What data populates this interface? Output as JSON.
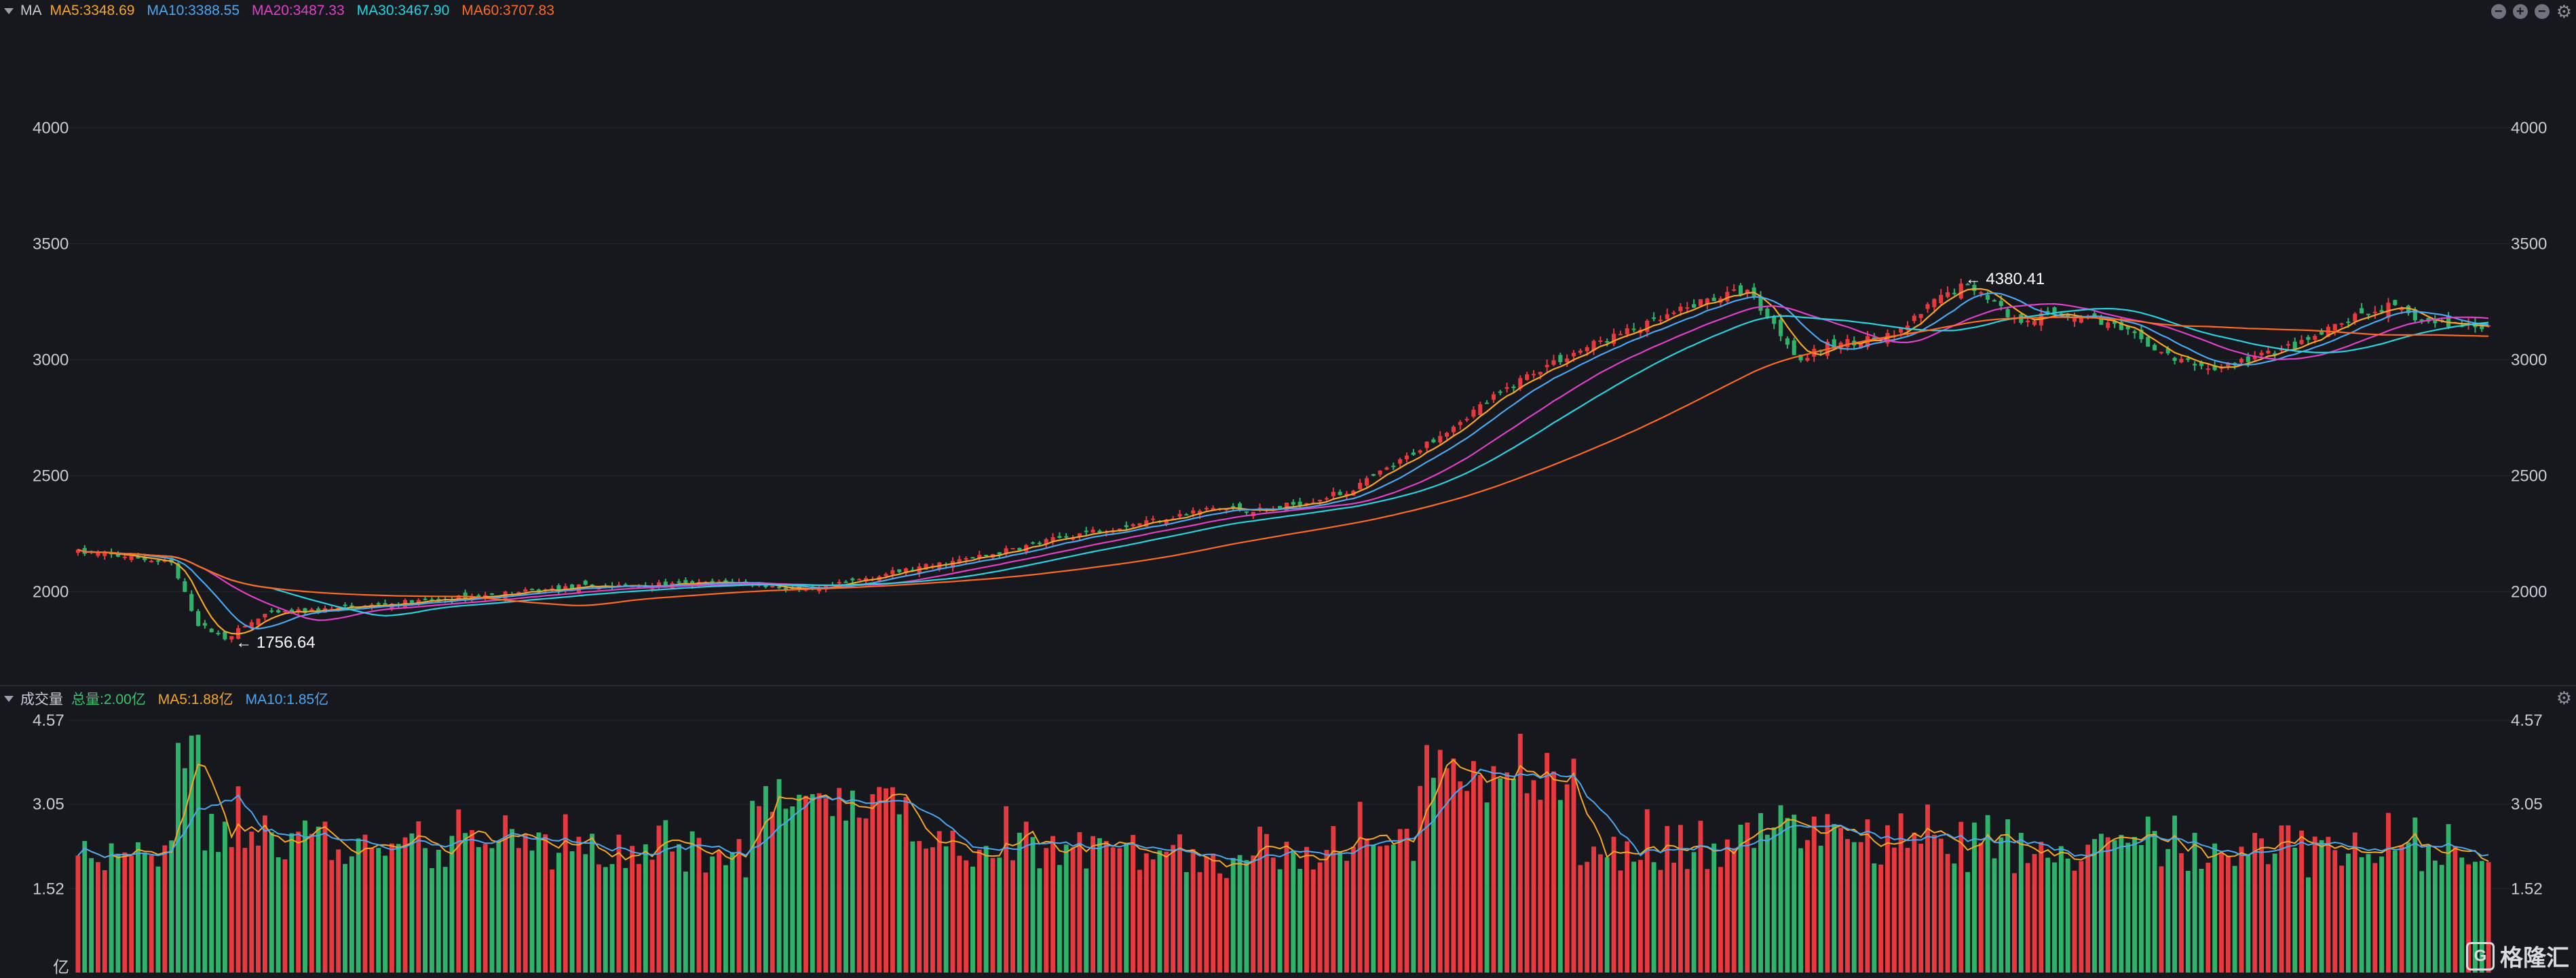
{
  "price_panel": {
    "indicator": "MA",
    "legend": [
      {
        "label": "MA5:3348.69",
        "color": "#f5a623"
      },
      {
        "label": "MA10:3388.55",
        "color": "#4aa7f2"
      },
      {
        "label": "MA20:3487.33",
        "color": "#e040c8"
      },
      {
        "label": "MA30:3467.90",
        "color": "#27d3e0"
      },
      {
        "label": "MA60:3707.83",
        "color": "#ff6a1f"
      }
    ],
    "max_label": "4380.41",
    "min_label": "1756.64"
  },
  "volume_panel": {
    "title": "成交量",
    "legend": [
      {
        "label": "总量:2.00亿",
        "color": "#39c26f"
      },
      {
        "label": "MA5:1.88亿",
        "color": "#f5a623"
      },
      {
        "label": "MA10:1.85亿",
        "color": "#4aa7f2"
      }
    ],
    "unit": "亿"
  },
  "logo": {
    "text": "格隆汇"
  },
  "colors": {
    "up": "#e8393f",
    "down": "#2fb36b",
    "grid": "#23262d",
    "axis_text": "#c9ccd4"
  },
  "chart_data": [
    {
      "type": "candlestick",
      "series": [
        {
          "name": "MA5"
        },
        {
          "name": "MA10"
        },
        {
          "name": "MA20"
        },
        {
          "name": "MA30"
        },
        {
          "name": "MA60"
        }
      ],
      "y_ticks": [
        2000,
        2500,
        3000,
        3500,
        4000
      ],
      "ylim": [
        1650,
        4440
      ],
      "num_candles": 362,
      "close_path": [
        [
          0,
          2170
        ],
        [
          8,
          2150
        ],
        [
          14,
          2120
        ],
        [
          18,
          1860
        ],
        [
          22,
          1800
        ],
        [
          28,
          1900
        ],
        [
          40,
          1930
        ],
        [
          60,
          1980
        ],
        [
          75,
          2020
        ],
        [
          90,
          2030
        ],
        [
          100,
          2040
        ],
        [
          110,
          2000
        ],
        [
          118,
          2060
        ],
        [
          135,
          2150
        ],
        [
          150,
          2250
        ],
        [
          165,
          2330
        ],
        [
          170,
          2360
        ],
        [
          178,
          2350
        ],
        [
          190,
          2430
        ],
        [
          198,
          2560
        ],
        [
          210,
          2800
        ],
        [
          218,
          2950
        ],
        [
          228,
          3080
        ],
        [
          236,
          3160
        ],
        [
          244,
          3260
        ],
        [
          250,
          3300
        ],
        [
          254,
          3150
        ],
        [
          258,
          3000
        ],
        [
          262,
          3060
        ],
        [
          268,
          3090
        ],
        [
          272,
          3100
        ],
        [
          278,
          3250
        ],
        [
          282,
          3320
        ],
        [
          285,
          3300
        ],
        [
          290,
          3170
        ],
        [
          296,
          3200
        ],
        [
          302,
          3180
        ],
        [
          308,
          3100
        ],
        [
          314,
          3000
        ],
        [
          320,
          2960
        ],
        [
          326,
          3010
        ],
        [
          334,
          3080
        ],
        [
          340,
          3170
        ],
        [
          346,
          3230
        ],
        [
          352,
          3160
        ],
        [
          360,
          3150
        ]
      ],
      "ma_endpoints": {
        "MA5": 3348.69,
        "MA10": 3388.55,
        "MA20": 3487.33,
        "MA30": 3467.9,
        "MA60": 3707.83
      }
    },
    {
      "type": "bar",
      "y_ticks": [
        1.52,
        3.05,
        4.57
      ],
      "ylim": [
        0,
        4.57
      ],
      "last_total": 2.0,
      "ma5_last": 1.88,
      "ma10_last": 1.85
    }
  ]
}
